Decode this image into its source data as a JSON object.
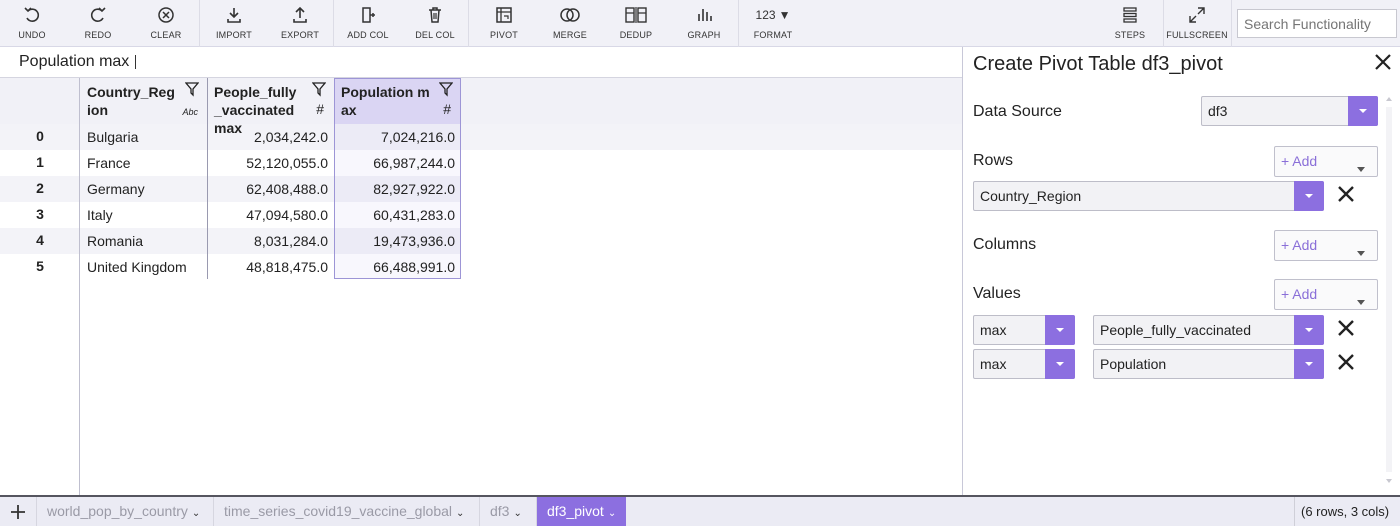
{
  "toolbar": {
    "undo": "UNDO",
    "redo": "REDO",
    "clear": "CLEAR",
    "import": "IMPORT",
    "export": "EXPORT",
    "add_col": "ADD COL",
    "del_col": "DEL COL",
    "pivot": "PIVOT",
    "merge": "MERGE",
    "dedup": "DEDUP",
    "graph": "GRAPH",
    "format_value": "123",
    "format": "FORMAT",
    "steps": "STEPS",
    "fullscreen": "FULLSCREEN",
    "search_placeholder": "Search Functionality"
  },
  "formula_bar": {
    "text": "Population max"
  },
  "table": {
    "columns": [
      {
        "name": "Country_Region",
        "type": "Abc"
      },
      {
        "name": "People_fully_vaccinated max",
        "type": "#"
      },
      {
        "name": "Population max",
        "type": "#"
      }
    ],
    "index": [
      "0",
      "1",
      "2",
      "3",
      "4",
      "5"
    ],
    "rows": [
      [
        "Bulgaria",
        "2,034,242.0",
        "7,024,216.0"
      ],
      [
        "France",
        "52,120,055.0",
        "66,987,244.0"
      ],
      [
        "Germany",
        "62,408,488.0",
        "82,927,922.0"
      ],
      [
        "Italy",
        "47,094,580.0",
        "60,431,283.0"
      ],
      [
        "Romania",
        "8,031,284.0",
        "19,473,936.0"
      ],
      [
        "United Kingdom",
        "48,818,475.0",
        "66,488,991.0"
      ]
    ]
  },
  "panel": {
    "title": "Create Pivot Table df3_pivot",
    "data_source_label": "Data Source",
    "data_source_value": "df3",
    "rows_label": "Rows",
    "rows_value": "Country_Region",
    "columns_label": "Columns",
    "values_label": "Values",
    "add_label": "+ Add",
    "values": [
      {
        "agg": "max",
        "field": "People_fully_vaccinated"
      },
      {
        "agg": "max",
        "field": "Population"
      }
    ]
  },
  "tabs": {
    "items": [
      "world_pop_by_country",
      "time_series_covid19_vaccine_global",
      "df3",
      "df3_pivot"
    ],
    "active": "df3_pivot",
    "status": "(6 rows, 3 cols)"
  },
  "colors": {
    "accent": "#8c6fe0",
    "toolbar_bg": "#f1f1f7"
  }
}
